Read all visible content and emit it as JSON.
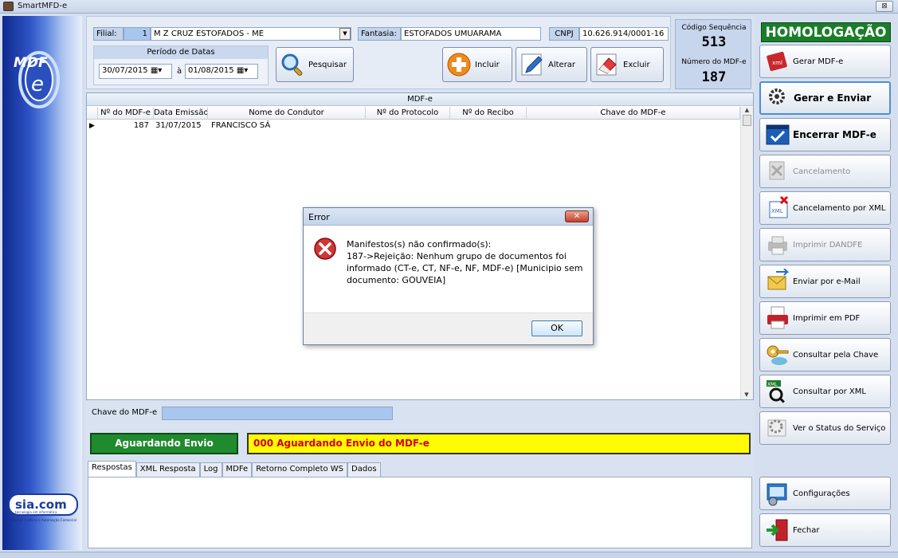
{
  "window": {
    "title": "SmartMFD-e",
    "close": "⊠"
  },
  "header": {
    "filial_label": "Filial:",
    "filial_code": "1",
    "filial_name": "M Z CRUZ ESTOFADOS - ME",
    "fantasia_label": "Fantasia:",
    "fantasia_value": "ESTOFADOS UMUARAMA",
    "cnpj_label": "CNPJ",
    "cnpj_value": "10.626.914/0001-16"
  },
  "period": {
    "title": "Período de Datas",
    "from": "30/07/2015",
    "to_label": "à",
    "to": "01/08/2015"
  },
  "toolbar": {
    "search": "Pesquisar",
    "add": "Incluir",
    "edit": "Alterar",
    "delete": "Excluir"
  },
  "sequence": {
    "code_label": "Código Sequência",
    "code_value": "513",
    "number_label": "Número do MDF-e",
    "number_value": "187"
  },
  "grid": {
    "title": "MDF-e",
    "columns": [
      "Nº do MDF-e",
      "Data Emissão",
      "Nome do Condutor",
      "Nº do Protocolo",
      "Nº do Recibo",
      "Chave do MDF-e"
    ],
    "rows": [
      {
        "numero": "187",
        "data": "31/07/2015",
        "condutor": "FRANCISCO SÁ",
        "protocolo": "",
        "recibo": "",
        "chave": ""
      }
    ]
  },
  "chave": {
    "label": "Chave do MDF-e",
    "value": ""
  },
  "status": {
    "badge": "Aguardando Envio",
    "message": "000  Aguardando Envio do MDF-e"
  },
  "tabs": [
    "Respostas",
    "XML Resposta",
    "Log",
    "MDFe",
    "Retorno Completo WS",
    "Dados"
  ],
  "right": {
    "env": "HOMOLOGAÇÃO",
    "buttons": [
      "Gerar MDF-e",
      "Gerar e Enviar",
      "Encerrar MDF-e",
      "Cancelamento",
      "Cancelamento por XML",
      "Imprimir DANDFE",
      "Enviar por e-Mail",
      "Imprimir em PDF",
      "Consultar pela Chave",
      "Consultar por XML",
      "Ver o Status do Serviço",
      "Configurações",
      "Fechar"
    ]
  },
  "dialog": {
    "title": "Error",
    "line1": "Manifestos(s) não confirmado(s):",
    "line2": "187->Rejeição: Nenhum grupo de documentos foi informado (CT-e, CT, NF-e, NF, MDF-e) [Municipio sem documento: GOUVEIA]",
    "ok": "OK",
    "close": "✕"
  },
  "logos": {
    "mdf_text": "MDF",
    "mdf_e": "e",
    "sia_text": "sia.com",
    "sia_sub": "tecnologia em informática",
    "sia_tagline": "Sistemas Gráficos e Automação Comercial"
  },
  "colors": {
    "homolog": "#1a7d2a",
    "status_green": "#1f8a2e",
    "status_yellow": "#fffb00",
    "status_red_text": "#d0000f"
  }
}
